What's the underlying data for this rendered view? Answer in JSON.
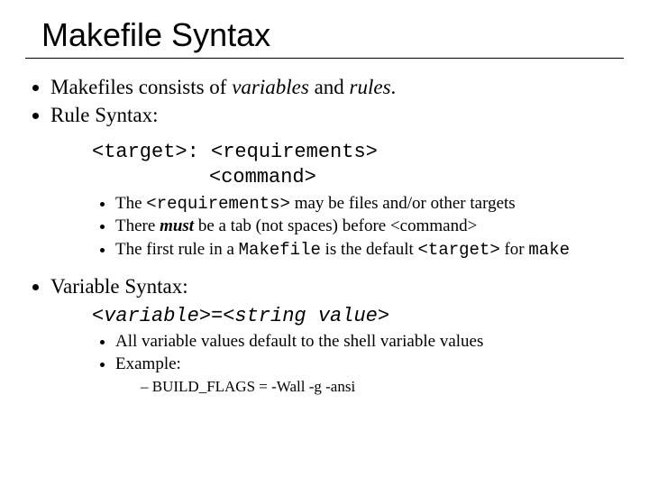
{
  "title": "Makefile Syntax",
  "bullets": {
    "b1_pre": "Makefiles consists of ",
    "b1_var": "variables",
    "b1_mid": " and ",
    "b1_rules": "rules",
    "b1_post": ".",
    "b2": "Rule Syntax:",
    "b3": "Variable Syntax:"
  },
  "rule_code": {
    "line1_a": "<target>: <requirements>",
    "line2_a": "<command>"
  },
  "rule_sub": {
    "s1_pre": "The ",
    "s1_code": "<requirements>",
    "s1_post": " may be files and/or other targets",
    "s2_pre": "There ",
    "s2_must": "must",
    "s2_post": " be a tab (not spaces) before <command>",
    "s3_pre": "The first rule in a ",
    "s3_mk": "Makefile",
    "s3_mid": " is the default ",
    "s3_code": "<target>",
    "s3_post": " for ",
    "s3_make": "make"
  },
  "var_code": {
    "line": "<variable>=<string value>"
  },
  "var_sub": {
    "s1": "All variable values default to the shell variable values",
    "s2": "Example:",
    "s3": "BUILD_FLAGS  = -Wall -g -ansi"
  }
}
